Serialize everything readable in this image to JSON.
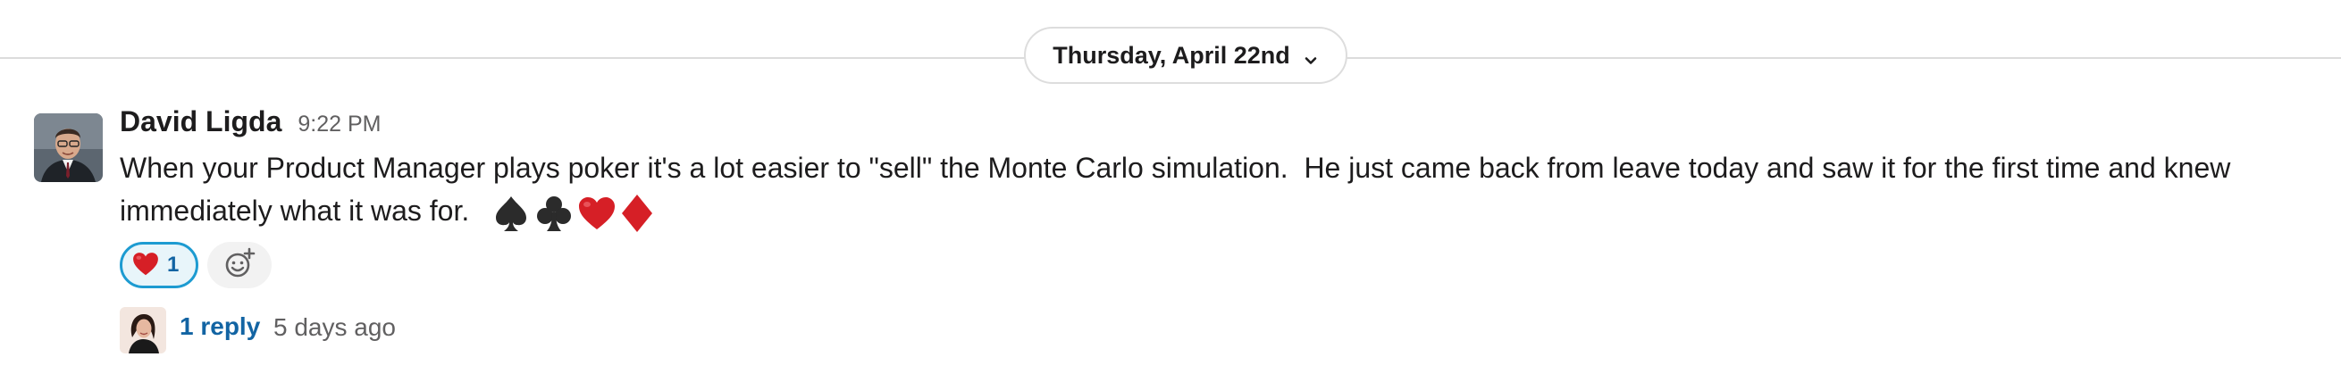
{
  "divider": {
    "date_label": "Thursday, April 22nd"
  },
  "message": {
    "author": "David Ligda",
    "time": "9:22 PM",
    "text": "When your Product Manager plays poker it's a lot easier to \"sell\" the Monte Carlo simulation.  He just came back from leave today and saw it for the first time and knew immediately what it was for.",
    "emoji": [
      "spade",
      "club",
      "heart",
      "diamond"
    ]
  },
  "reactions": [
    {
      "emoji": "heart",
      "count": "1"
    }
  ],
  "thread": {
    "reply_count_label": "1 reply",
    "last_reply": "5 days ago"
  },
  "colors": {
    "link": "#1264a3",
    "reaction_border": "#1d9bd1",
    "reaction_bg": "#e8f5fa",
    "muted_text": "#616061",
    "heart": "#d61f26"
  }
}
